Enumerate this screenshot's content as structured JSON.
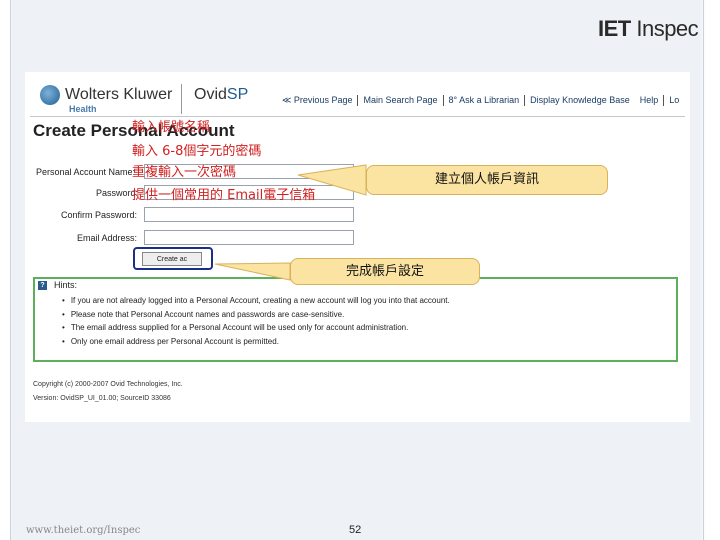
{
  "brand": {
    "iet_logo_bold": "IET",
    "iet_logo_rest": " Inspec"
  },
  "header": {
    "wk_name": "Wolters Kluwer",
    "wk_sub": "Health",
    "ovid_a": "Ovid",
    "ovid_b": "SP",
    "nav": [
      "≪ Previous Page",
      "Main Search Page",
      "8° Ask a Librarian",
      "Display Knowledge Base",
      "Help",
      "Lo"
    ]
  },
  "page_title": "Create Personal Account",
  "form": {
    "labels": [
      "Personal Account Name:",
      "Password:",
      "Confirm Password:",
      "Email Address:"
    ],
    "values": [
      "",
      "",
      "",
      ""
    ],
    "button": "Create ac"
  },
  "hints": {
    "title": "Hints:",
    "icon": "?",
    "items": [
      "If you are not already logged into a Personal Account, creating a new account will log you into that account.",
      "Please note that Personal Account names and passwords are case-sensitive.",
      "The email address supplied for a Personal Account will be used only for account administration.",
      "Only one email address per Personal Account is permitted."
    ]
  },
  "footer": {
    "copyright": "Copyright (c) 2000-2007 Ovid Technologies, Inc.",
    "version": "Version: OvidSP_UI_01.00; SourceID 33086"
  },
  "annotations": {
    "name": "輸入帳號名稱",
    "password": "輸入 6-8個字元的密碼",
    "confirm": "重複輸入一次密碼",
    "email": "提供一個常用的 Email電子信箱"
  },
  "callouts": {
    "create_info": "建立個人帳戶資訊",
    "complete": "完成帳戶設定"
  },
  "slide": {
    "url": "www.theiet.org/Inspec",
    "number": "52"
  },
  "colors": {
    "accent_blue": "#1a2f86",
    "callout_fill": "#fbe3a1",
    "hints_border": "#5cb05c",
    "annotation_red": "#d02020"
  }
}
